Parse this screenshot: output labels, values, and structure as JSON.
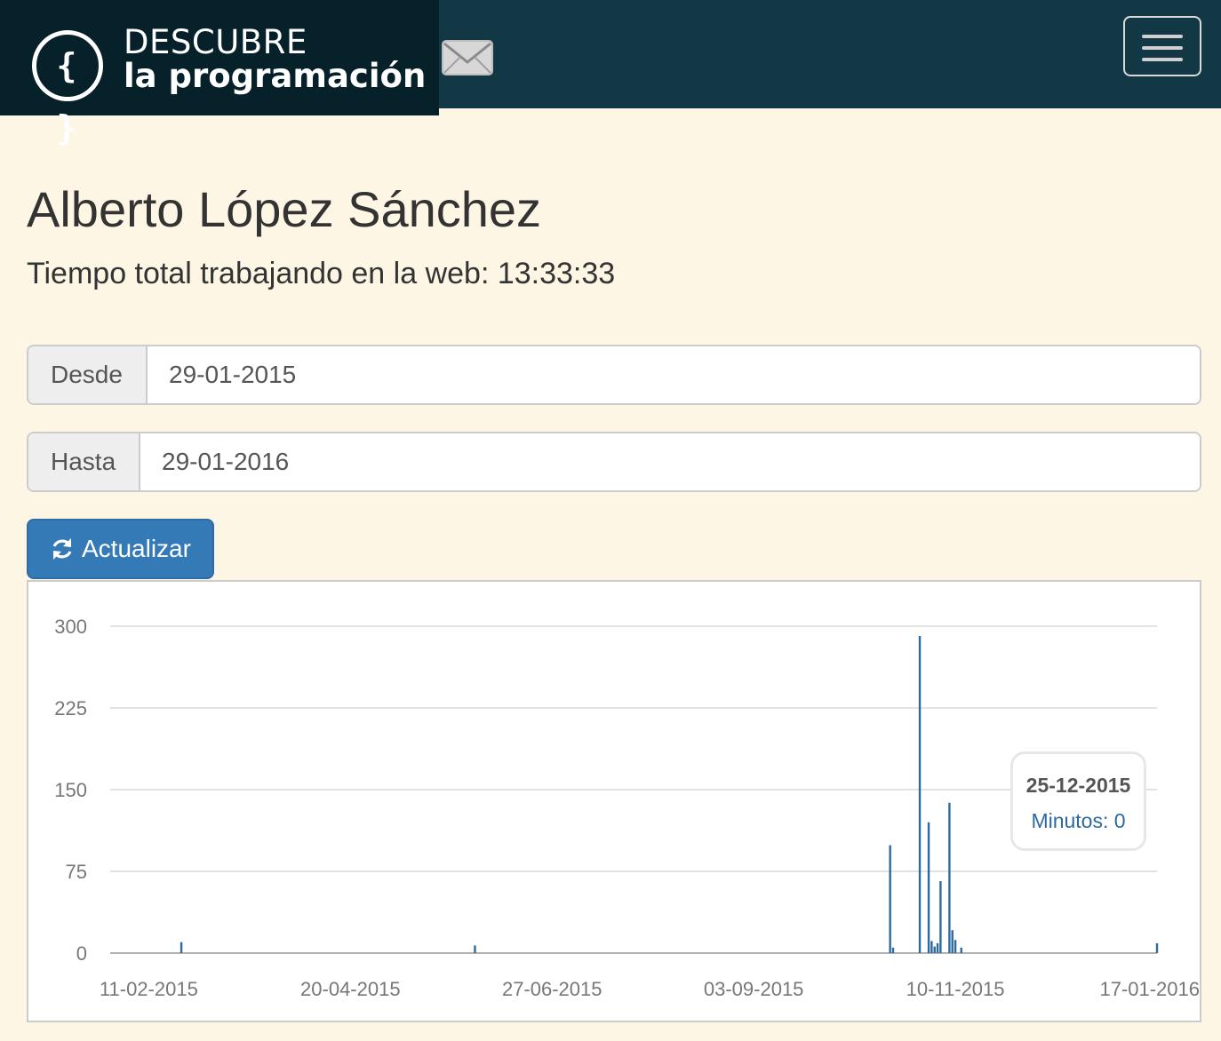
{
  "navbar": {
    "brand_line1": "DESCUBRE",
    "brand_line2": "la programación",
    "brand_logo_text": "{ }",
    "mail_icon": "envelope-icon",
    "menu_icon": "hamburger-menu-icon",
    "colors": {
      "navbar_bg": "#123846",
      "brand_bg": "#07212a"
    }
  },
  "profile": {
    "name": "Alberto López Sánchez",
    "total_time_label": "Tiempo total trabajando en la web: 13:33:33"
  },
  "filters": {
    "from_label": "Desde",
    "from_value": "29-01-2015",
    "to_label": "Hasta",
    "to_value": "29-01-2016",
    "update_label": "Actualizar",
    "update_icon": "refresh-icon",
    "button_color": "#337ab7"
  },
  "chart_data": {
    "type": "bar",
    "ylim": [
      0,
      300
    ],
    "y_ticks": [
      "0",
      "75",
      "150",
      "225",
      "300"
    ],
    "x_range": [
      "2015-01-29",
      "2016-01-17"
    ],
    "x_ticks": [
      {
        "date": "2015-02-11",
        "label": "11-02-2015"
      },
      {
        "date": "2015-04-20",
        "label": "20-04-2015"
      },
      {
        "date": "2015-06-27",
        "label": "27-06-2015"
      },
      {
        "date": "2015-09-03",
        "label": "03-09-2015"
      },
      {
        "date": "2015-11-10",
        "label": "10-11-2015"
      },
      {
        "date": "2016-01-17",
        "label": "17-01-2016"
      }
    ],
    "bar_color": "#2c6aa0",
    "grid": true,
    "points": [
      {
        "date": "2015-02-22",
        "value": 10
      },
      {
        "date": "2015-06-01",
        "value": 7
      },
      {
        "date": "2015-10-19",
        "value": 99
      },
      {
        "date": "2015-10-20",
        "value": 5
      },
      {
        "date": "2015-10-29",
        "value": 291
      },
      {
        "date": "2015-11-01",
        "value": 120
      },
      {
        "date": "2015-11-02",
        "value": 11
      },
      {
        "date": "2015-11-03",
        "value": 6
      },
      {
        "date": "2015-11-04",
        "value": 9
      },
      {
        "date": "2015-11-05",
        "value": 66
      },
      {
        "date": "2015-11-08",
        "value": 138
      },
      {
        "date": "2015-11-09",
        "value": 21
      },
      {
        "date": "2015-11-10",
        "value": 12
      },
      {
        "date": "2015-11-12",
        "value": 5
      },
      {
        "date": "2016-01-17",
        "value": 9
      }
    ],
    "tooltip": {
      "date": "25-12-2015",
      "value_label": "Minutos: 0"
    }
  }
}
